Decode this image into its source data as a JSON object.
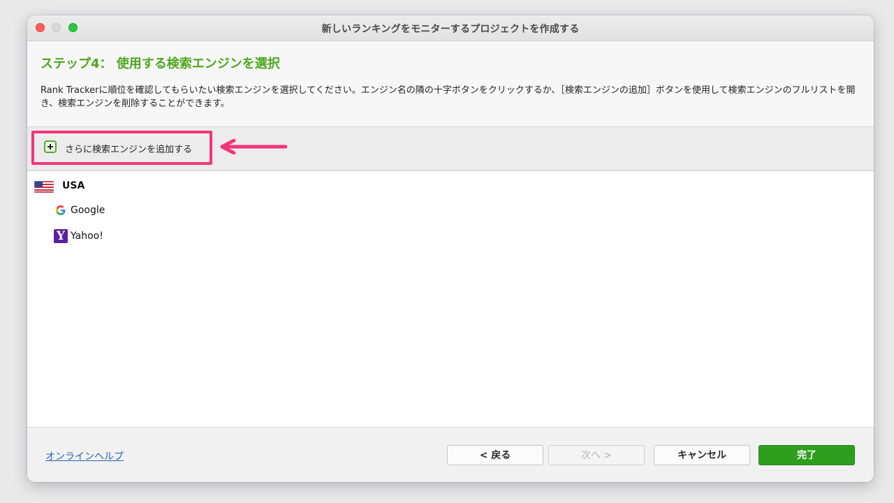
{
  "window": {
    "title": "新しいランキングをモニターするプロジェクトを作成する"
  },
  "header": {
    "step_title": "ステップ4： 使用する検索エンジンを選択",
    "description": "Rank Trackerに順位を確認してもらいたい検索エンジンを選択してください。エンジン名の隣の十字ボタンをクリックするか、［検索エンジンの追加］ボタンを使用して検索エンジンのフルリストを開き、検索エンジンを削除することができます。"
  },
  "toolbar": {
    "add_button_label": "さらに検索エンジンを追加する",
    "highlight_color": "#f2357a"
  },
  "engine_list": {
    "country": {
      "label": "USA",
      "icon": "us-flag-icon"
    },
    "engines": [
      {
        "label": "Google",
        "icon": "google-icon"
      },
      {
        "label": "Yahoo!",
        "icon": "yahoo-icon"
      }
    ]
  },
  "footer": {
    "help_link": "オンラインヘルプ",
    "back_label": "< 戻る",
    "next_label": "次へ >",
    "cancel_label": "キャンセル",
    "finish_label": "完了"
  },
  "colors": {
    "accent_green": "#4fa61e",
    "finish_button": "#2e9e1e",
    "link": "#2a63b8"
  }
}
